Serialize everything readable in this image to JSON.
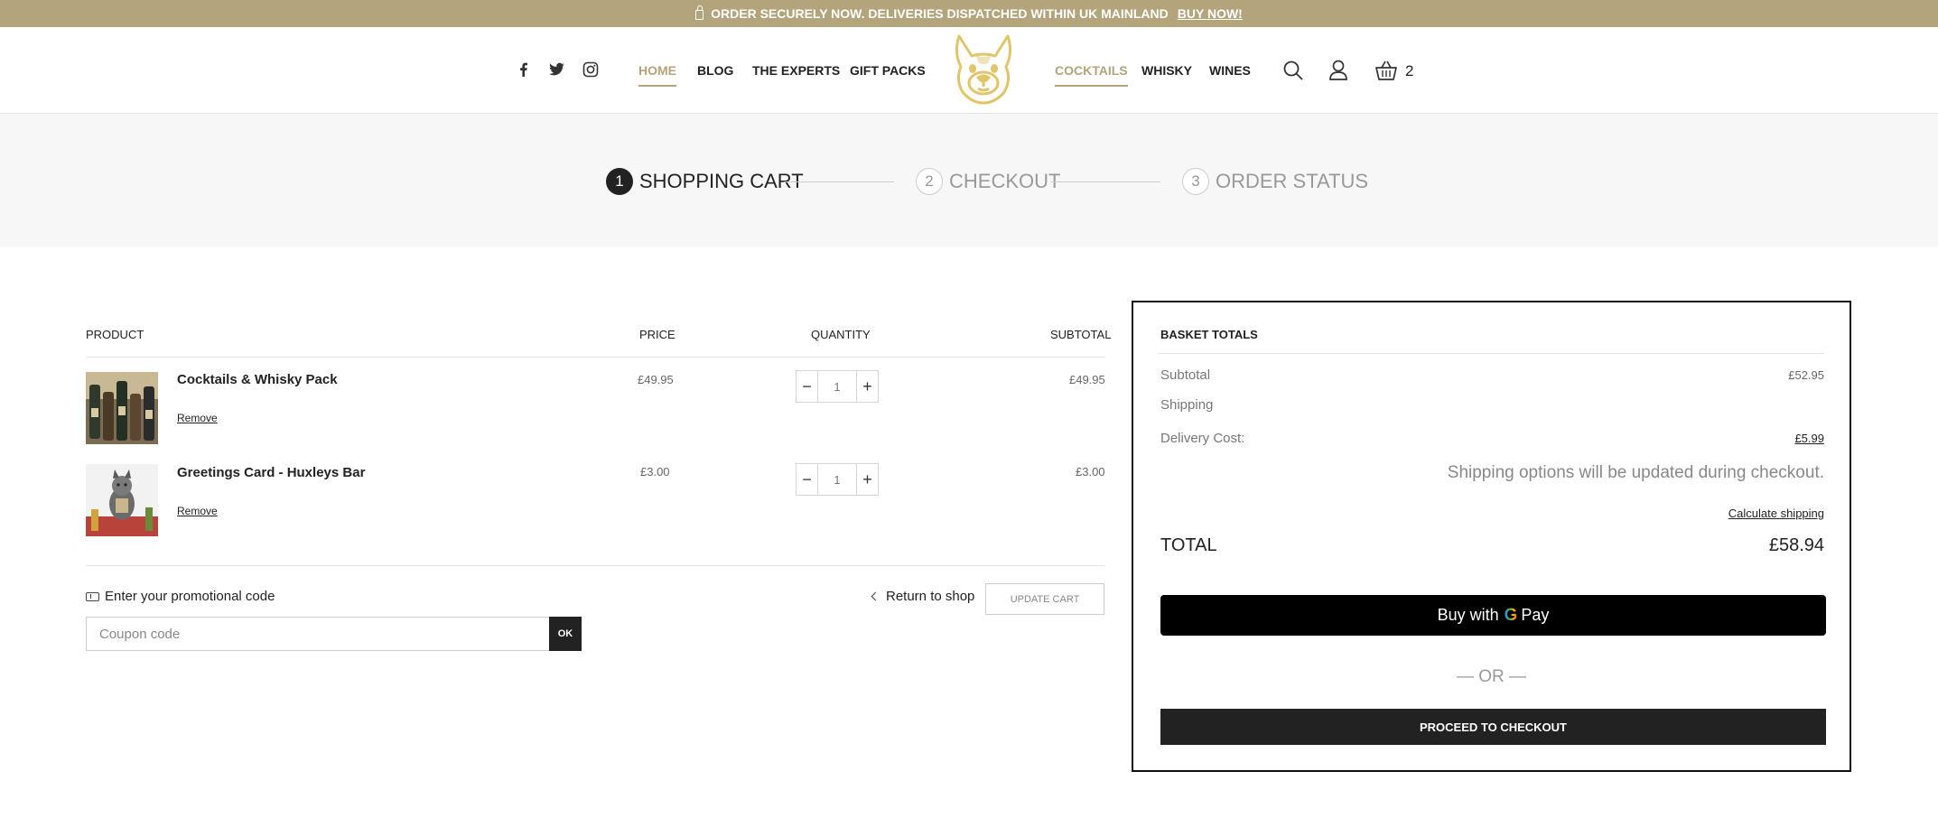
{
  "topbar": {
    "message": "ORDER SECURELY NOW. DELIVERIES DISPATCHED WITHIN UK MAINLAND",
    "link": "BUY NOW!"
  },
  "nav": {
    "left": [
      {
        "label": "HOME",
        "active": true
      },
      {
        "label": "BLOG",
        "active": false
      },
      {
        "label": "THE EXPERTS",
        "active": false
      },
      {
        "label": "GIFT PACKS",
        "active": false
      }
    ],
    "right": [
      {
        "label": "COCKTAILS",
        "active": true
      },
      {
        "label": "WHISKY",
        "active": false
      },
      {
        "label": "WINES",
        "active": false
      }
    ],
    "basket_count": "2"
  },
  "steps": [
    {
      "num": "1",
      "label": "SHOPPING CART",
      "active": true
    },
    {
      "num": "2",
      "label": "CHECKOUT",
      "active": false
    },
    {
      "num": "3",
      "label": "ORDER STATUS",
      "active": false
    }
  ],
  "cart": {
    "headers": {
      "product": "PRODUCT",
      "price": "PRICE",
      "quantity": "QUANTITY",
      "subtotal": "SUBTOTAL"
    },
    "items": [
      {
        "name": "Cocktails & Whisky Pack",
        "remove": "Remove",
        "price": "£49.95",
        "qty": "1",
        "subtotal": "£49.95"
      },
      {
        "name": "Greetings Card - Huxleys Bar",
        "remove": "Remove",
        "price": "£3.00",
        "qty": "1",
        "subtotal": "£3.00"
      }
    ],
    "promo_label": "Enter your promotional code",
    "coupon_placeholder": "Coupon code",
    "ok": "OK",
    "return_label": "Return to shop",
    "update_label": "UPDATE CART"
  },
  "totals": {
    "title": "BASKET TOTALS",
    "subtotal_label": "Subtotal",
    "subtotal_value": "£52.95",
    "shipping_label": "Shipping",
    "delivery_label": "Delivery Cost:",
    "delivery_value": "£5.99",
    "shipping_note": "Shipping options will be updated during checkout.",
    "calc_label": "Calculate shipping",
    "total_label": "TOTAL",
    "total_value": "£58.94",
    "gpay_prefix": "Buy with",
    "gpay_g": "G",
    "gpay_suffix": "Pay",
    "or_label": "— OR —",
    "proceed_label": "PROCEED TO CHECKOUT"
  },
  "colors": {
    "accent": "#b3a47b",
    "dark": "#222222"
  }
}
